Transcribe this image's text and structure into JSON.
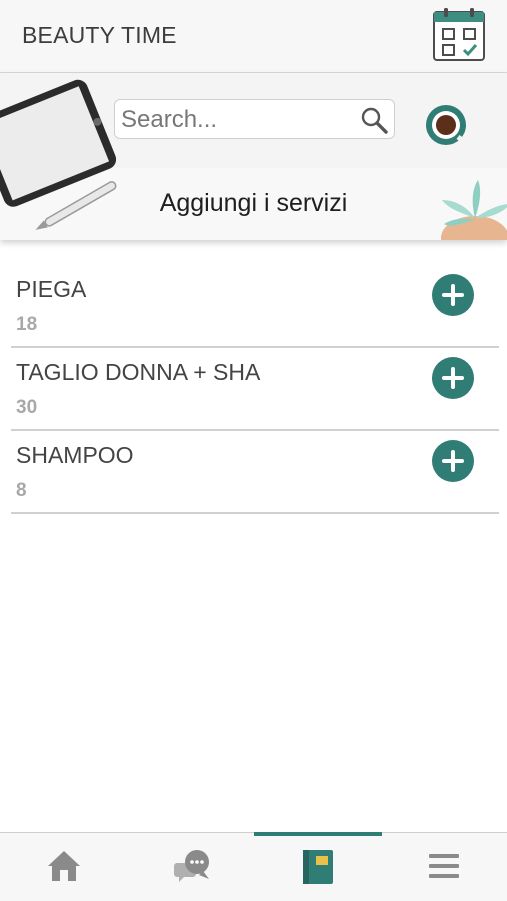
{
  "header": {
    "title": "BEAUTY TIME",
    "calendar_icon": "calendar-check-icon"
  },
  "banner": {
    "search_placeholder": "Search...",
    "search_icon": "search-icon",
    "coffee_icon": "coffee-cup-icon",
    "title": "Aggiungi i servizi"
  },
  "services": [
    {
      "name": "PIEGA",
      "value": "18"
    },
    {
      "name": "TAGLIO DONNA + SHA",
      "value": "30"
    },
    {
      "name": "SHAMPOO",
      "value": "8"
    }
  ],
  "nav": {
    "items": [
      {
        "icon": "home-icon",
        "active": false
      },
      {
        "icon": "chat-icon",
        "active": false
      },
      {
        "icon": "notebook-icon",
        "active": true
      },
      {
        "icon": "menu-icon",
        "active": false
      }
    ]
  },
  "colors": {
    "accent": "#2f7d74",
    "header_bg": "#f7f7f7"
  }
}
